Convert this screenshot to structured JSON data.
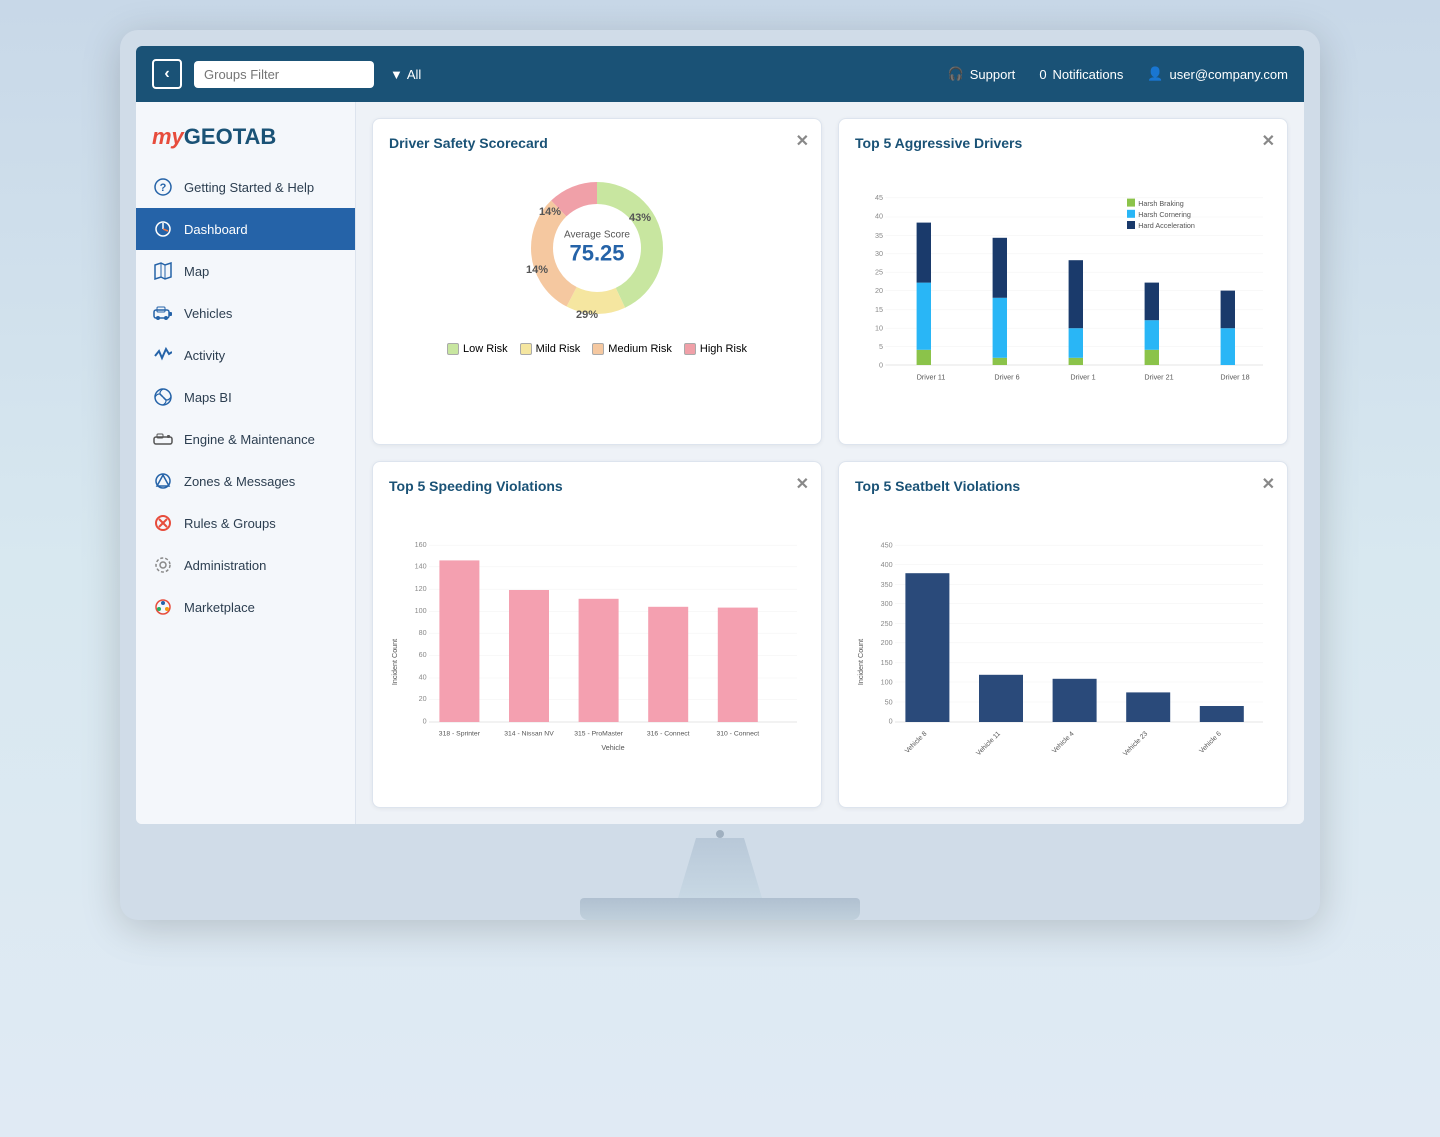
{
  "topbar": {
    "back_label": "‹",
    "groups_filter": "Groups Filter",
    "all_label": "All",
    "support_label": "Support",
    "notifications_count": "0",
    "notifications_label": "Notifications",
    "user_email": "user@company.com"
  },
  "logo": {
    "my": "my",
    "geotab": "GEOTAB"
  },
  "sidebar": {
    "items": [
      {
        "label": "Getting Started & Help",
        "icon": "help"
      },
      {
        "label": "Dashboard",
        "icon": "dashboard",
        "active": true
      },
      {
        "label": "Map",
        "icon": "map"
      },
      {
        "label": "Vehicles",
        "icon": "vehicles"
      },
      {
        "label": "Activity",
        "icon": "activity"
      },
      {
        "label": "Maps BI",
        "icon": "mapsbi"
      },
      {
        "label": "Engine & Maintenance",
        "icon": "engine"
      },
      {
        "label": "Zones & Messages",
        "icon": "zones"
      },
      {
        "label": "Rules & Groups",
        "icon": "rules"
      },
      {
        "label": "Administration",
        "icon": "admin"
      },
      {
        "label": "Marketplace",
        "icon": "marketplace"
      }
    ]
  },
  "scorecard": {
    "title": "Driver Safety Scorecard",
    "avg_label": "Average Score",
    "score": "75.25",
    "segments": [
      {
        "label": "Low Risk",
        "color": "#c8e6a0",
        "pct": 43
      },
      {
        "label": "Mild Risk",
        "color": "#f5e6a0",
        "pct": 14
      },
      {
        "label": "Medium Risk",
        "color": "#f5c8a0",
        "pct": 29
      },
      {
        "label": "High Risk",
        "color": "#f0a0a8",
        "pct": 14
      }
    ],
    "pct_labels": [
      {
        "text": "43%",
        "angle": 50
      },
      {
        "text": "14%",
        "angle": 130
      },
      {
        "text": "14%",
        "angle": 220
      },
      {
        "text": "29%",
        "angle": 290
      }
    ]
  },
  "aggressive_drivers": {
    "title": "Top 5 Aggressive Drivers",
    "y_max": 45,
    "y_ticks": [
      0,
      5,
      10,
      15,
      20,
      25,
      30,
      35,
      40,
      45
    ],
    "drivers": [
      {
        "label": "Driver 11",
        "harsh_braking": 4,
        "harsh_cornering": 18,
        "hard_acceleration": 16
      },
      {
        "label": "Driver 6",
        "harsh_braking": 2,
        "harsh_cornering": 16,
        "hard_acceleration": 16
      },
      {
        "label": "Driver 1",
        "harsh_braking": 2,
        "harsh_cornering": 8,
        "hard_acceleration": 18
      },
      {
        "label": "Driver 21",
        "harsh_braking": 4,
        "harsh_cornering": 8,
        "hard_acceleration": 10
      },
      {
        "label": "Driver 18",
        "harsh_braking": 0,
        "harsh_cornering": 8,
        "hard_acceleration": 10
      }
    ],
    "legend": [
      {
        "label": "Harsh Braking",
        "color": "#8bc34a"
      },
      {
        "label": "Harsh Cornering",
        "color": "#29b6f6"
      },
      {
        "label": "Hard Acceleration",
        "color": "#1a3a6b"
      }
    ]
  },
  "speeding": {
    "title": "Top 5 Speeding Violations",
    "y_label": "Incident Count",
    "x_label": "Vehicle",
    "y_max": 160,
    "y_ticks": [
      0,
      20,
      40,
      60,
      80,
      100,
      120,
      140,
      160
    ],
    "bars": [
      {
        "label": "318 - Sprinter",
        "value": 147
      },
      {
        "label": "314 - Nissan NV",
        "value": 120
      },
      {
        "label": "315 - ProMaster",
        "value": 112
      },
      {
        "label": "316 - Connect",
        "value": 105
      },
      {
        "label": "310 - Connect",
        "value": 104
      }
    ],
    "bar_color": "#f4a0b0"
  },
  "seatbelt": {
    "title": "Top 5 Seatbelt Violations",
    "y_label": "Incident Count",
    "y_max": 450,
    "y_ticks": [
      0,
      50,
      100,
      150,
      200,
      250,
      300,
      350,
      400,
      450
    ],
    "bars": [
      {
        "label": "Vehicle 8",
        "value": 380
      },
      {
        "label": "Vehicle 11",
        "value": 120
      },
      {
        "label": "Vehicle 4",
        "value": 110
      },
      {
        "label": "Vehicle 23",
        "value": 75
      },
      {
        "label": "Vehicle 6",
        "value": 40
      }
    ],
    "bar_color": "#2a4a7a"
  }
}
